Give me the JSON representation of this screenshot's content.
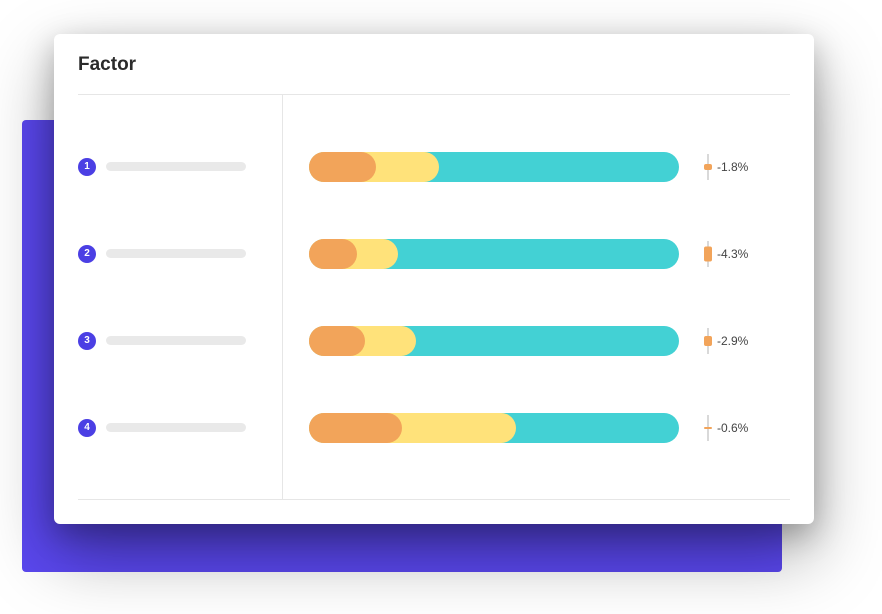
{
  "card": {
    "title": "Factor"
  },
  "rows": [
    {
      "badge": "1",
      "segments": {
        "orange": 18,
        "yellow": 35,
        "cyan": 100
      },
      "pct_label": "-1.8%",
      "pct_abs": 1.8
    },
    {
      "badge": "2",
      "segments": {
        "orange": 13,
        "yellow": 24,
        "cyan": 100
      },
      "pct_label": "-4.3%",
      "pct_abs": 4.3
    },
    {
      "badge": "3",
      "segments": {
        "orange": 15,
        "yellow": 29,
        "cyan": 100
      },
      "pct_label": "-2.9%",
      "pct_abs": 2.9
    },
    {
      "badge": "4",
      "segments": {
        "orange": 25,
        "yellow": 56,
        "cyan": 100
      },
      "pct_label": "-0.6%",
      "pct_abs": 0.6
    }
  ],
  "colors": {
    "accent": "#5b48f0",
    "badge": "#4b3fe4",
    "cyan": "#43d1d4",
    "yellow": "#ffe27a",
    "orange": "#f2a45a"
  },
  "chart_data": {
    "type": "bar",
    "title": "Factor",
    "categories": [
      "1",
      "2",
      "3",
      "4"
    ],
    "series": [
      {
        "name": "orange",
        "values": [
          18,
          13,
          15,
          25
        ]
      },
      {
        "name": "yellow",
        "values": [
          35,
          24,
          29,
          56
        ]
      },
      {
        "name": "cyan",
        "values": [
          100,
          100,
          100,
          100
        ]
      }
    ],
    "deltas_pct": [
      -1.8,
      -4.3,
      -2.9,
      -0.6
    ],
    "xlabel": "",
    "ylabel": "",
    "ylim": [
      0,
      100
    ]
  }
}
